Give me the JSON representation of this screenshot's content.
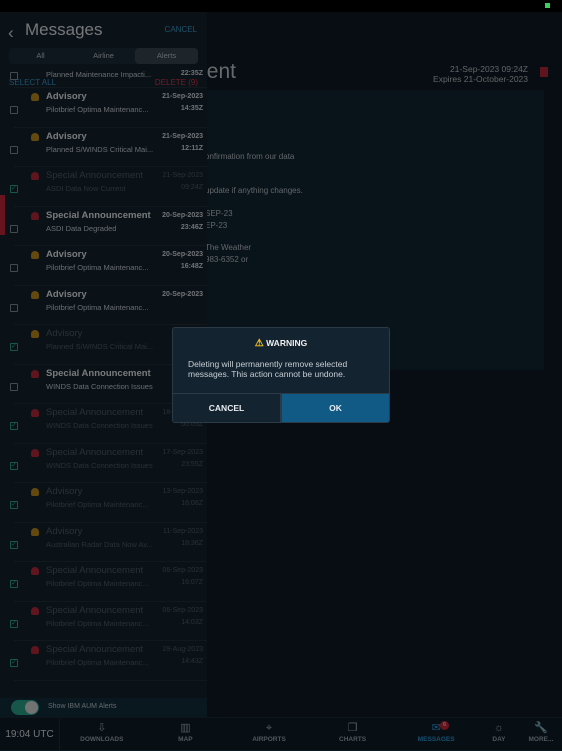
{
  "detail": {
    "title_fragment": "nent",
    "date": "21-Sep-2023 09:24Z",
    "expires": "Expires 21-October-2023",
    "body_fragments": [
      "onfirmation from our data",
      "update if anything changes.",
      "SEP-23",
      "EP-23",
      "The Weather",
      "983-6352 or"
    ]
  },
  "messages": {
    "back_icon": "chevron-left-icon",
    "title": "Messages",
    "cancel": "CANCEL",
    "segments": [
      {
        "label": "All"
      },
      {
        "label": "Airline"
      },
      {
        "label": "Alerts",
        "active": true
      }
    ],
    "select_all": "SELECT ALL",
    "delete": "DELETE (9)",
    "rows": [
      {
        "title": "",
        "subtitle": "Planned Maintenance Impacti...",
        "date": "",
        "time": "22:35Z",
        "type": "advisory",
        "checked": false
      },
      {
        "title": "Advisory",
        "subtitle": "Pilotbrief Optima Maintenanc...",
        "date": "21-Sep-2023",
        "time": "14:35Z",
        "type": "advisory",
        "checked": false
      },
      {
        "title": "Advisory",
        "subtitle": "Planned S/WINDS Critical Mai...",
        "date": "21-Sep-2023",
        "time": "12:11Z",
        "type": "advisory",
        "checked": false
      },
      {
        "title": "Special Announcement",
        "subtitle": "ASDI Data Now Current",
        "date": "21-Sep-2023",
        "time": "09:24Z",
        "type": "special",
        "checked": true
      },
      {
        "title": "Special Announcement",
        "subtitle": "ASDI Data Degraded",
        "date": "20-Sep-2023",
        "time": "23:46Z",
        "type": "special",
        "checked": false
      },
      {
        "title": "Advisory",
        "subtitle": "Pilotbrief Optima Maintenanc...",
        "date": "20-Sep-2023",
        "time": "16:48Z",
        "type": "advisory",
        "checked": false
      },
      {
        "title": "Advisory",
        "subtitle": "Pilotbrief Optima Maintenanc...",
        "date": "20-Sep-2023",
        "time": "",
        "type": "advisory",
        "checked": false
      },
      {
        "title": "Advisory",
        "subtitle": "Planned S/WINDS Critical Mai...",
        "date": "",
        "time": "",
        "type": "advisory",
        "checked": true
      },
      {
        "title": "Special Announcement",
        "subtitle": "WINDS Data Connection Issues",
        "date": "",
        "time": "",
        "type": "special",
        "checked": false
      },
      {
        "title": "Special Announcement",
        "subtitle": "WINDS Data Connection Issues",
        "date": "18-Sep-2023",
        "time": "00:05Z",
        "type": "special",
        "checked": true
      },
      {
        "title": "Special Announcement",
        "subtitle": "WINDS Data Connection Issues",
        "date": "17-Sep-2023",
        "time": "23:55Z",
        "type": "special",
        "checked": true
      },
      {
        "title": "Advisory",
        "subtitle": "Pilotbrief Optima Maintenanc...",
        "date": "13-Sep-2023",
        "time": "16:06Z",
        "type": "advisory",
        "checked": true
      },
      {
        "title": "Advisory",
        "subtitle": "Australian Radar Data Now Av...",
        "date": "11-Sep-2023",
        "time": "18:36Z",
        "type": "advisory",
        "checked": true
      },
      {
        "title": "Special Announcement",
        "subtitle": "Pilotbrief Optima Maintenanc...",
        "date": "06-Sep-2023",
        "time": "16:07Z",
        "type": "special",
        "checked": true
      },
      {
        "title": "Special Announcement",
        "subtitle": "Pilotbrief Optima Maintenanc...",
        "date": "06-Sep-2023",
        "time": "14:03Z",
        "type": "special",
        "checked": true
      },
      {
        "title": "Special Announcement",
        "subtitle": "Pilotbrief Optima Maintenanc...",
        "date": "29-Aug-2023",
        "time": "14:43Z",
        "type": "special",
        "checked": true
      }
    ],
    "toggle_label": "Show IBM AUM Alerts",
    "toggle_on": true
  },
  "colors": {
    "advisory": "#c8921e",
    "special": "#c0283a",
    "accent": "#2f9fe0",
    "toggle": "#2fae92"
  },
  "tabbar": {
    "clock": "19:04 UTC",
    "tabs": [
      {
        "label": "DOWNLOADS",
        "icon": "download-icon",
        "glyph": "⇩"
      },
      {
        "label": "MAP",
        "icon": "map-icon",
        "glyph": "▥"
      },
      {
        "label": "AIRPORTS",
        "icon": "airport-icon",
        "glyph": "⌖"
      },
      {
        "label": "CHARTS",
        "icon": "charts-icon",
        "glyph": "❐"
      },
      {
        "label": "MESSAGES",
        "icon": "envelope-icon",
        "glyph": "✉",
        "active": true,
        "badge": "6"
      },
      {
        "label": "DAY",
        "icon": "sun-icon",
        "glyph": "☼"
      },
      {
        "label": "MORE...",
        "icon": "wrench-icon",
        "glyph": "🔧"
      }
    ]
  },
  "dialog": {
    "title": "WARNING",
    "message": "Deleting will permanently remove selected messages. This action cannot be undone.",
    "cancel": "CANCEL",
    "ok": "OK"
  }
}
